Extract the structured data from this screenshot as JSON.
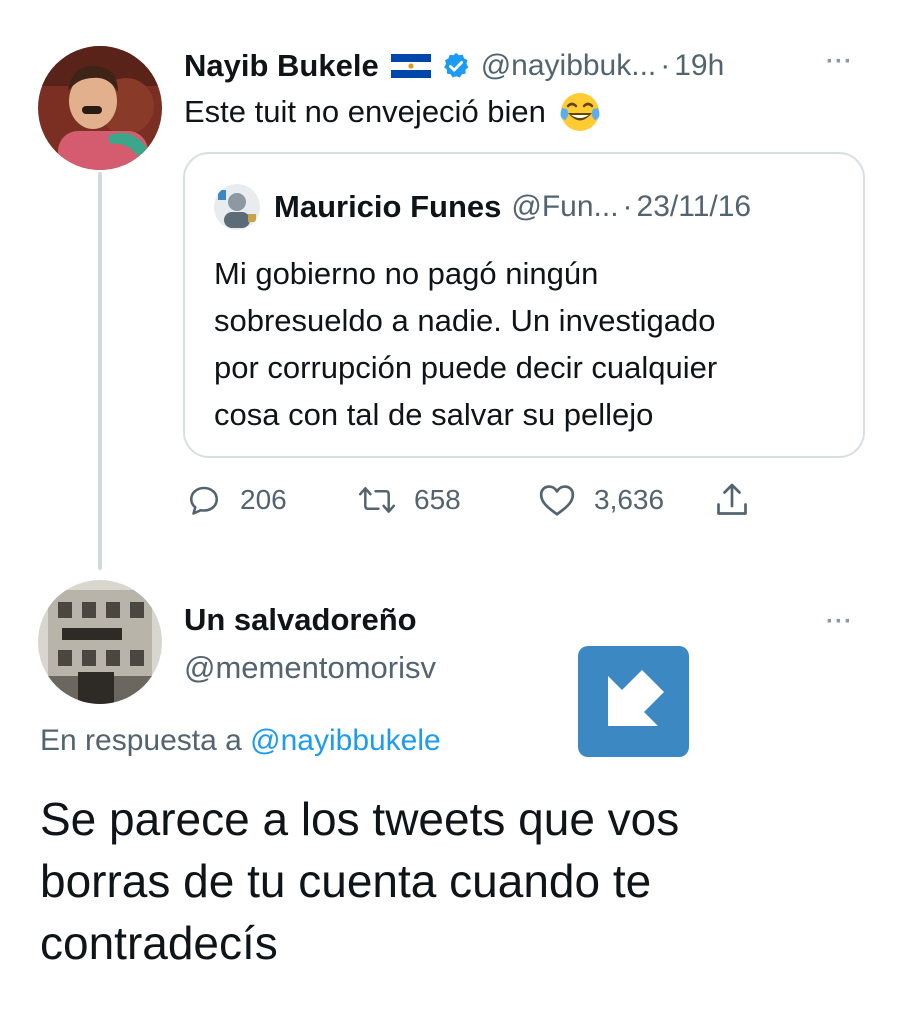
{
  "tweet": {
    "author": {
      "name": "Nayib Bukele",
      "handle": "@nayibbuk...",
      "flag_icon": "el-salvador-flag-icon",
      "verified_icon": "verified-badge-icon"
    },
    "time": "19h",
    "text": "Este tuit no envejeció bien",
    "emoji_icon": "face-with-tears-of-joy-icon",
    "more_label": "···",
    "quoted": {
      "author_name": "Mauricio Funes",
      "handle": "@Fun...",
      "date": "23/11/16",
      "text_lines": [
        "Mi gobierno no pagó ningún",
        "sobresueldo a nadie. Un investigado",
        "por corrupción puede decir cualquier",
        "cosa con tal de salvar su pellejo"
      ]
    },
    "actions": {
      "reply_count": "206",
      "retweet_count": "658",
      "like_count": "3,636"
    }
  },
  "reply": {
    "author_name": "Un salvadoreño",
    "handle": "@mementomorisv",
    "more_label": "···",
    "replying_prefix": "En respuesta a",
    "replying_to": "@nayibbukele",
    "text_lines": [
      "Se parece a los tweets que vos",
      "borras de tu cuenta cuando te",
      "contradecís"
    ],
    "sticker_icon": "down-left-arrow-icon"
  },
  "colors": {
    "text_primary": "#0f1419",
    "text_secondary": "#536471",
    "link": "#1d9bf0",
    "border": "#d8dfe3",
    "thread_line": "#cfd9de",
    "verified": "#1d9bf0",
    "arrow_box": "#3b88c3"
  }
}
